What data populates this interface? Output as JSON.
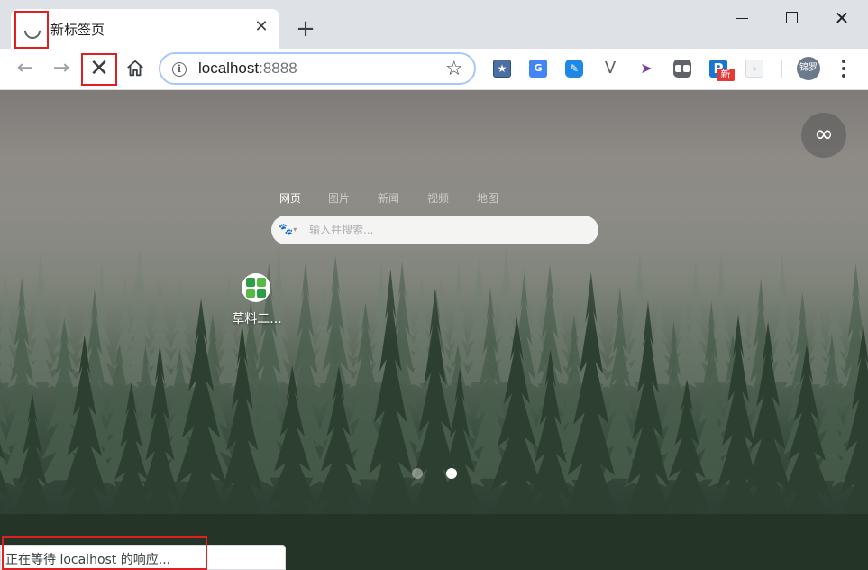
{
  "tab": {
    "title": "新标签页",
    "close_glyph": "✕",
    "loading_icon": "loading-spinner-icon"
  },
  "new_tab_glyph": "+",
  "window_controls": {
    "close_glyph": "✕"
  },
  "toolbar": {
    "back_glyph": "←",
    "forward_glyph": "→",
    "stop_glyph": "✕",
    "url_host": "localhost",
    "url_port": ":8888",
    "info_glyph": "i",
    "star_glyph": "☆",
    "extensions": [
      {
        "name": "bookmark-star-extension",
        "glyph": "★"
      },
      {
        "name": "google-translate-extension",
        "glyph": "G"
      },
      {
        "name": "blue-pen-extension",
        "glyph": "✎"
      },
      {
        "name": "vue-devtools-extension",
        "glyph": "V"
      },
      {
        "name": "cursor-extension",
        "glyph": "➤"
      },
      {
        "name": "two-squares-extension",
        "glyph": ""
      },
      {
        "name": "p-extension",
        "glyph": "P",
        "badge": "新"
      },
      {
        "name": "map-pin-extension",
        "glyph": "⌖"
      }
    ],
    "avatar_text": "锦罗"
  },
  "new_tab_page": {
    "infinity_glyph": "∞",
    "search_tabs": [
      {
        "label": "网页",
        "active": true
      },
      {
        "label": "图片",
        "active": false
      },
      {
        "label": "新闻",
        "active": false
      },
      {
        "label": "视频",
        "active": false
      },
      {
        "label": "地图",
        "active": false
      }
    ],
    "search_engine_glyph": "🐾",
    "search_engine_caret": "▾",
    "search_placeholder": "输入并搜索...",
    "shortcut": {
      "label": "草料二...",
      "colors": [
        "#2e9e46",
        "#58b947",
        "#2e9e46",
        "#58b947"
      ]
    },
    "pager_pages": 2,
    "pager_current": 2
  },
  "status": {
    "text": "正在等待 localhost 的响应..."
  },
  "colors": {
    "highlight_box": "#e02020",
    "tabstrip": "#dee1e6",
    "omnibox_border": "#a8c7fa"
  }
}
